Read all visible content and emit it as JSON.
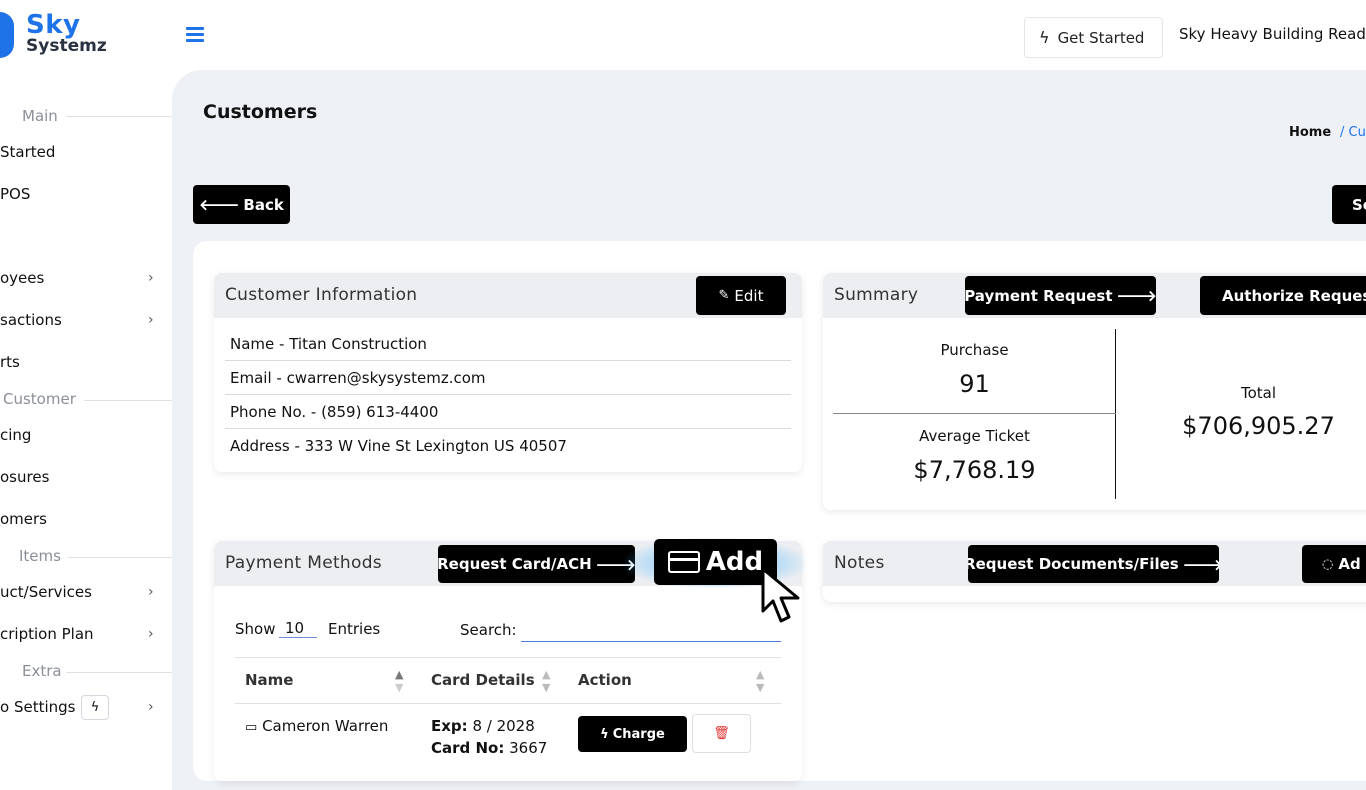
{
  "brand": {
    "line1": "Sky",
    "line2": "Systemz"
  },
  "header": {
    "get_started": "Get Started",
    "company": "Sky Heavy Building Ready"
  },
  "sidebar": {
    "sections": [
      {
        "label": "Main"
      },
      {
        "label": "Customer"
      },
      {
        "label": "Items"
      },
      {
        "label": "Extra"
      }
    ],
    "items": [
      {
        "label": "Started"
      },
      {
        "label": "POS"
      },
      {
        "label": "oyees"
      },
      {
        "label": "sactions"
      },
      {
        "label": "rts"
      },
      {
        "label": "cing"
      },
      {
        "label": "osures"
      },
      {
        "label": "omers"
      },
      {
        "label": "uct/Services"
      },
      {
        "label": "cription Plan"
      },
      {
        "label": "o Settings"
      }
    ]
  },
  "page": {
    "title": "Customers",
    "breadcrumb_home": "Home",
    "breadcrumb_current": "/ Cu",
    "back": "Back",
    "right_button": "Se"
  },
  "customer_info": {
    "title": "Customer Information",
    "edit": "Edit",
    "name": "Name - Titan Construction",
    "email": "Email - cwarren@skysystemz.com",
    "phone": "Phone No. - (859) 613-4400",
    "address": "Address - 333 W Vine St Lexington US 40507"
  },
  "summary": {
    "title": "Summary",
    "payment_request": "Payment Request",
    "authorize_request": "Authorize Request",
    "purchase_label": "Purchase",
    "purchase_value": "91",
    "avg_label": "Average Ticket",
    "avg_value": "$7,768.19",
    "total_label": "Total",
    "total_value": "$706,905.27"
  },
  "payment_methods": {
    "title": "Payment Methods",
    "request_card": "Request Card/ACH",
    "add": "Add",
    "show": "Show",
    "entries_value": "10",
    "entries": "Entries",
    "search": "Search:",
    "columns": [
      "Name",
      "Card Details",
      "Action"
    ],
    "rows": [
      {
        "name": "Cameron Warren",
        "exp_label": "Exp:",
        "exp": "8 / 2028",
        "card_label": "Card No:",
        "card": "3667",
        "charge": "Charge"
      }
    ]
  },
  "notes": {
    "title": "Notes",
    "request_docs": "Request Documents/Files",
    "add": "Ad"
  }
}
